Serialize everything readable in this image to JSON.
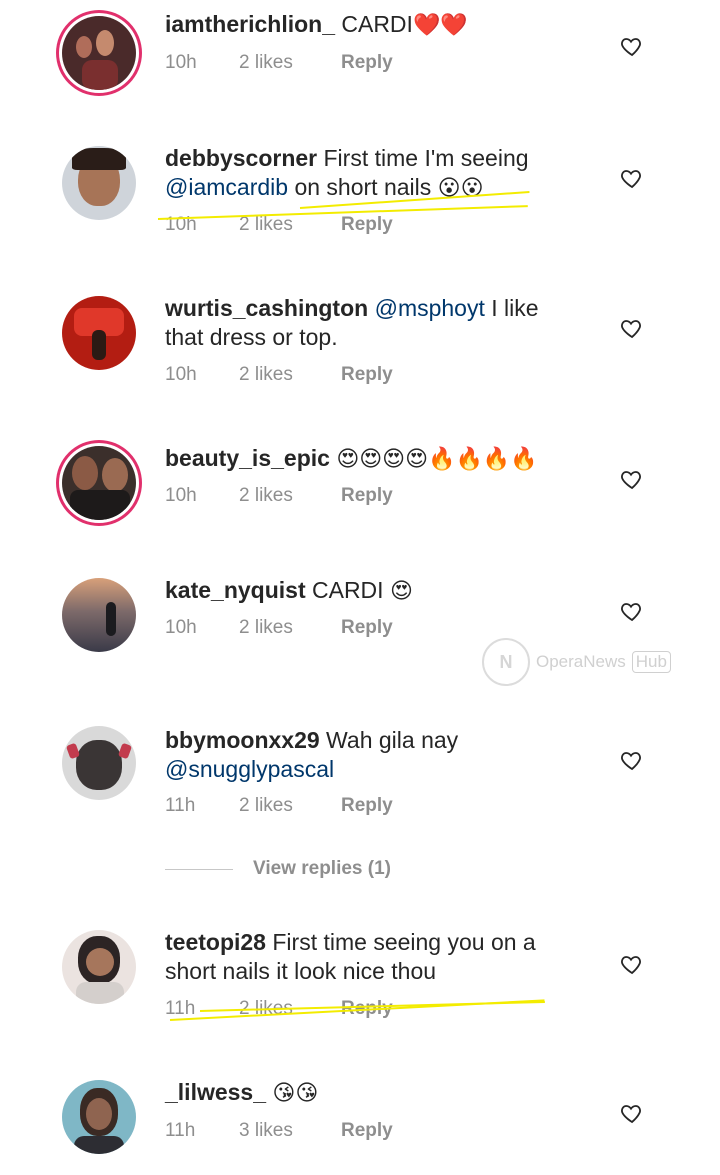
{
  "comments": [
    {
      "username": "iamtherichlion_",
      "text_before": "CARDI",
      "emoji": "❤️❤️",
      "text_after": "",
      "time": "10h",
      "likes": "2 likes",
      "reply": "Reply"
    },
    {
      "username": "debbyscorner",
      "text_before": "First time I'm seeing",
      "mention": "@iamcardib",
      "text_after": "on short nails",
      "emoji": "😮😮",
      "time": "10h",
      "likes": "2 likes",
      "reply": "Reply"
    },
    {
      "username": "wurtis_cashington",
      "mention": "@msphoyt",
      "text_after": "I like that dress or top.",
      "time": "10h",
      "likes": "2 likes",
      "reply": "Reply"
    },
    {
      "username": "beauty_is_epic",
      "emoji": "😍😍😍😍🔥🔥🔥🔥",
      "time": "10h",
      "likes": "2 likes",
      "reply": "Reply"
    },
    {
      "username": "kate_nyquist",
      "text_before": "CARDI",
      "emoji": "😍",
      "time": "10h",
      "likes": "2 likes",
      "reply": "Reply"
    },
    {
      "username": "bbymoonxx29",
      "text_before": "Wah gila nay",
      "mention": "@snugglypascal",
      "time": "11h",
      "likes": "2 likes",
      "reply": "Reply"
    },
    {
      "username": "teetopi28",
      "text_before": "First time seeing you on a short nails it look nice thou",
      "time": "11h",
      "likes": "2 likes",
      "reply": "Reply"
    },
    {
      "username": "_lilwess_",
      "emoji": "😘😘",
      "time": "11h",
      "likes": "3 likes",
      "reply": "Reply"
    }
  ],
  "view_replies": "View replies (1)",
  "watermark": {
    "brand": "OperaNews",
    "hub": "Hub",
    "logo_letter": "N"
  },
  "colors": {
    "highlight": "#f3ec00",
    "story_ring": "#e1306c",
    "mention": "#00376b",
    "meta": "#8e8e8e"
  }
}
